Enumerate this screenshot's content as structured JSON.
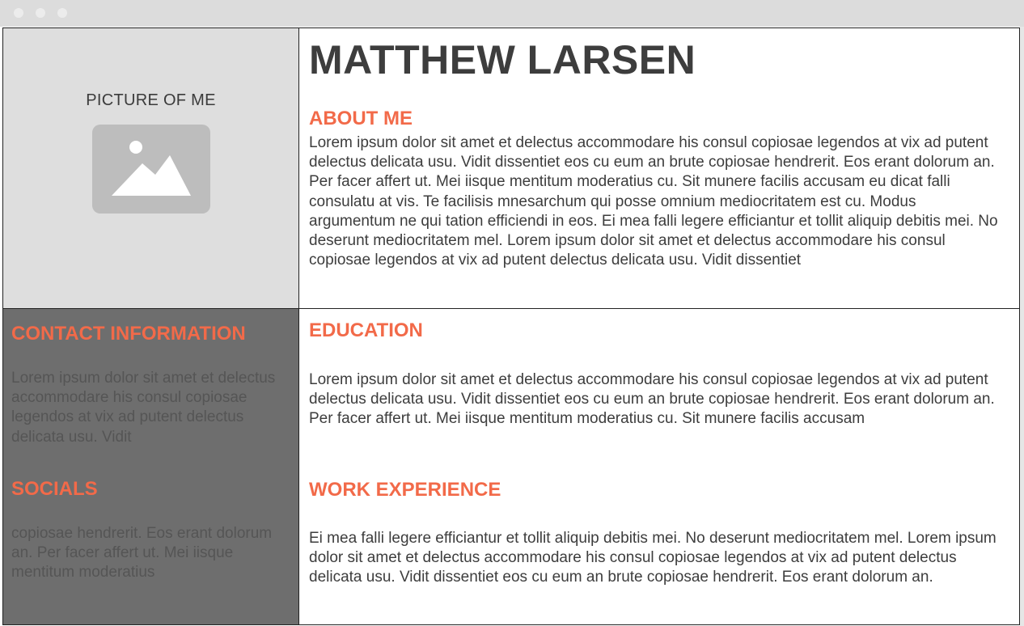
{
  "profile": {
    "name": "MATTHEW LARSEN",
    "picture_label": "PICTURE OF ME",
    "picture_icon": "image-placeholder-icon"
  },
  "about": {
    "heading": "ABOUT ME",
    "text": "Lorem ipsum dolor sit amet et delectus accommodare his consul copiosae legendos at vix ad putent delectus delicata usu. Vidit dissentiet eos cu eum an brute copiosae hendrerit. Eos erant dolorum an. Per facer affert ut. Mei iisque mentitum moderatius cu. Sit munere facilis accusam eu dicat falli consulatu at vis. Te facilisis mnesarchum qui posse omnium mediocritatem est cu. Modus argumentum ne qui tation efficiendi in eos. Ei mea falli legere efficiantur et tollit aliquip debitis mei. No deserunt mediocritatem mel. Lorem ipsum dolor sit amet et delectus accommodare his consul copiosae legendos at vix ad putent delectus delicata usu. Vidit dissentiet"
  },
  "contact": {
    "heading": "CONTACT INFORMATION",
    "text": "Lorem ipsum dolor sit amet et delectus accommodare his consul copiosae legendos at vix ad putent delectus delicata usu. Vidit"
  },
  "socials": {
    "heading": "SOCIALS",
    "text": "copiosae hendrerit. Eos erant dolorum an. Per facer affert ut. Mei iisque mentitum moderatius"
  },
  "education": {
    "heading": "EDUCATION",
    "text": "Lorem ipsum dolor sit amet et delectus accommodare his consul copiosae legendos at vix ad putent delectus delicata usu. Vidit dissentiet eos cu eum an brute copiosae hendrerit. Eos erant dolorum an. Per facer affert ut. Mei iisque mentitum moderatius cu. Sit munere facilis accusam"
  },
  "work": {
    "heading": "WORK EXPERIENCE",
    "text": "Ei mea falli legere efficiantur et tollit aliquip debitis mei. No deserunt mediocritatem mel. Lorem ipsum dolor sit amet et delectus accommodare his consul copiosae legendos at vix ad putent delectus delicata usu. Vidit dissentiet eos cu eum an brute copiosae hendrerit. Eos erant dolorum an."
  },
  "colors": {
    "accent": "#f26a49",
    "text": "#3d3d3d",
    "picture_bg": "#dedede",
    "sidebar_bg": "#6e6e6e"
  }
}
